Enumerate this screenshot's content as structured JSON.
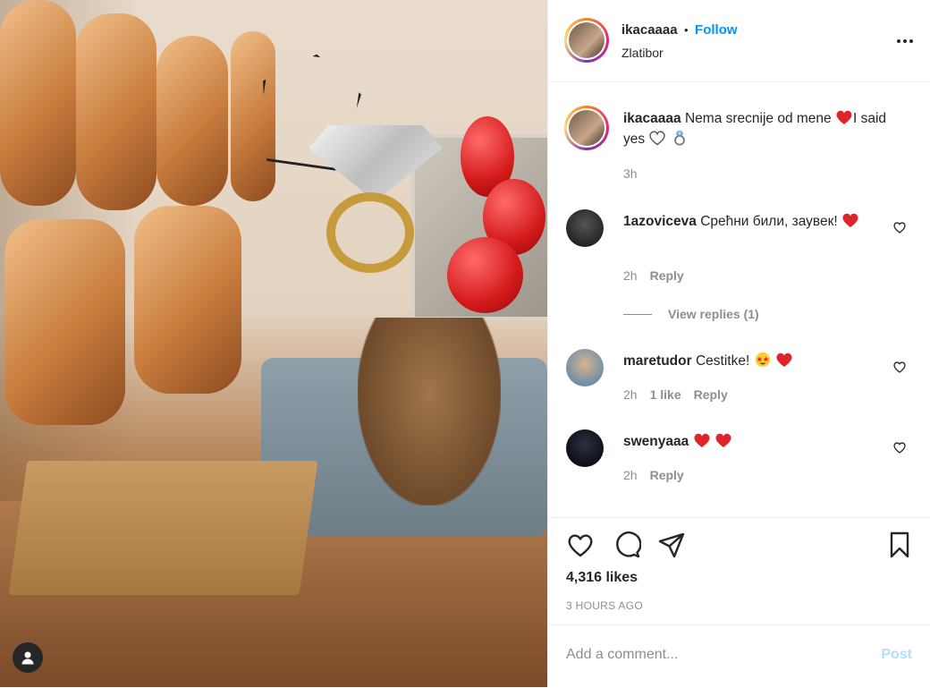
{
  "post": {
    "username": "ikacaaaa",
    "follow_label": "Follow",
    "separator": "•",
    "location": "Zlatibor",
    "more_icon": "more-horizontal-icon"
  },
  "caption": {
    "username": "ikacaaaa",
    "text_part1": "Nema srecnije od mene",
    "text_part2": "I said yes",
    "time": "3h"
  },
  "comments": [
    {
      "username": "1azoviceva",
      "text": "Срећни били, заувек!",
      "time": "2h",
      "reply_label": "Reply",
      "view_replies": "View replies (1)"
    },
    {
      "username": "maretudor",
      "text": "Cestitke!",
      "time": "2h",
      "likes_label": "1 like",
      "reply_label": "Reply"
    },
    {
      "username": "swenyaaa",
      "text": "",
      "time": "2h",
      "reply_label": "Reply"
    }
  ],
  "footer": {
    "likes": "4,316 likes",
    "posted": "3 HOURS AGO",
    "add_comment_placeholder": "Add a comment...",
    "post_label": "Post"
  },
  "colors": {
    "accent": "#0095f6",
    "heart_red": "#ed4956",
    "muted": "#8e8e8e"
  }
}
